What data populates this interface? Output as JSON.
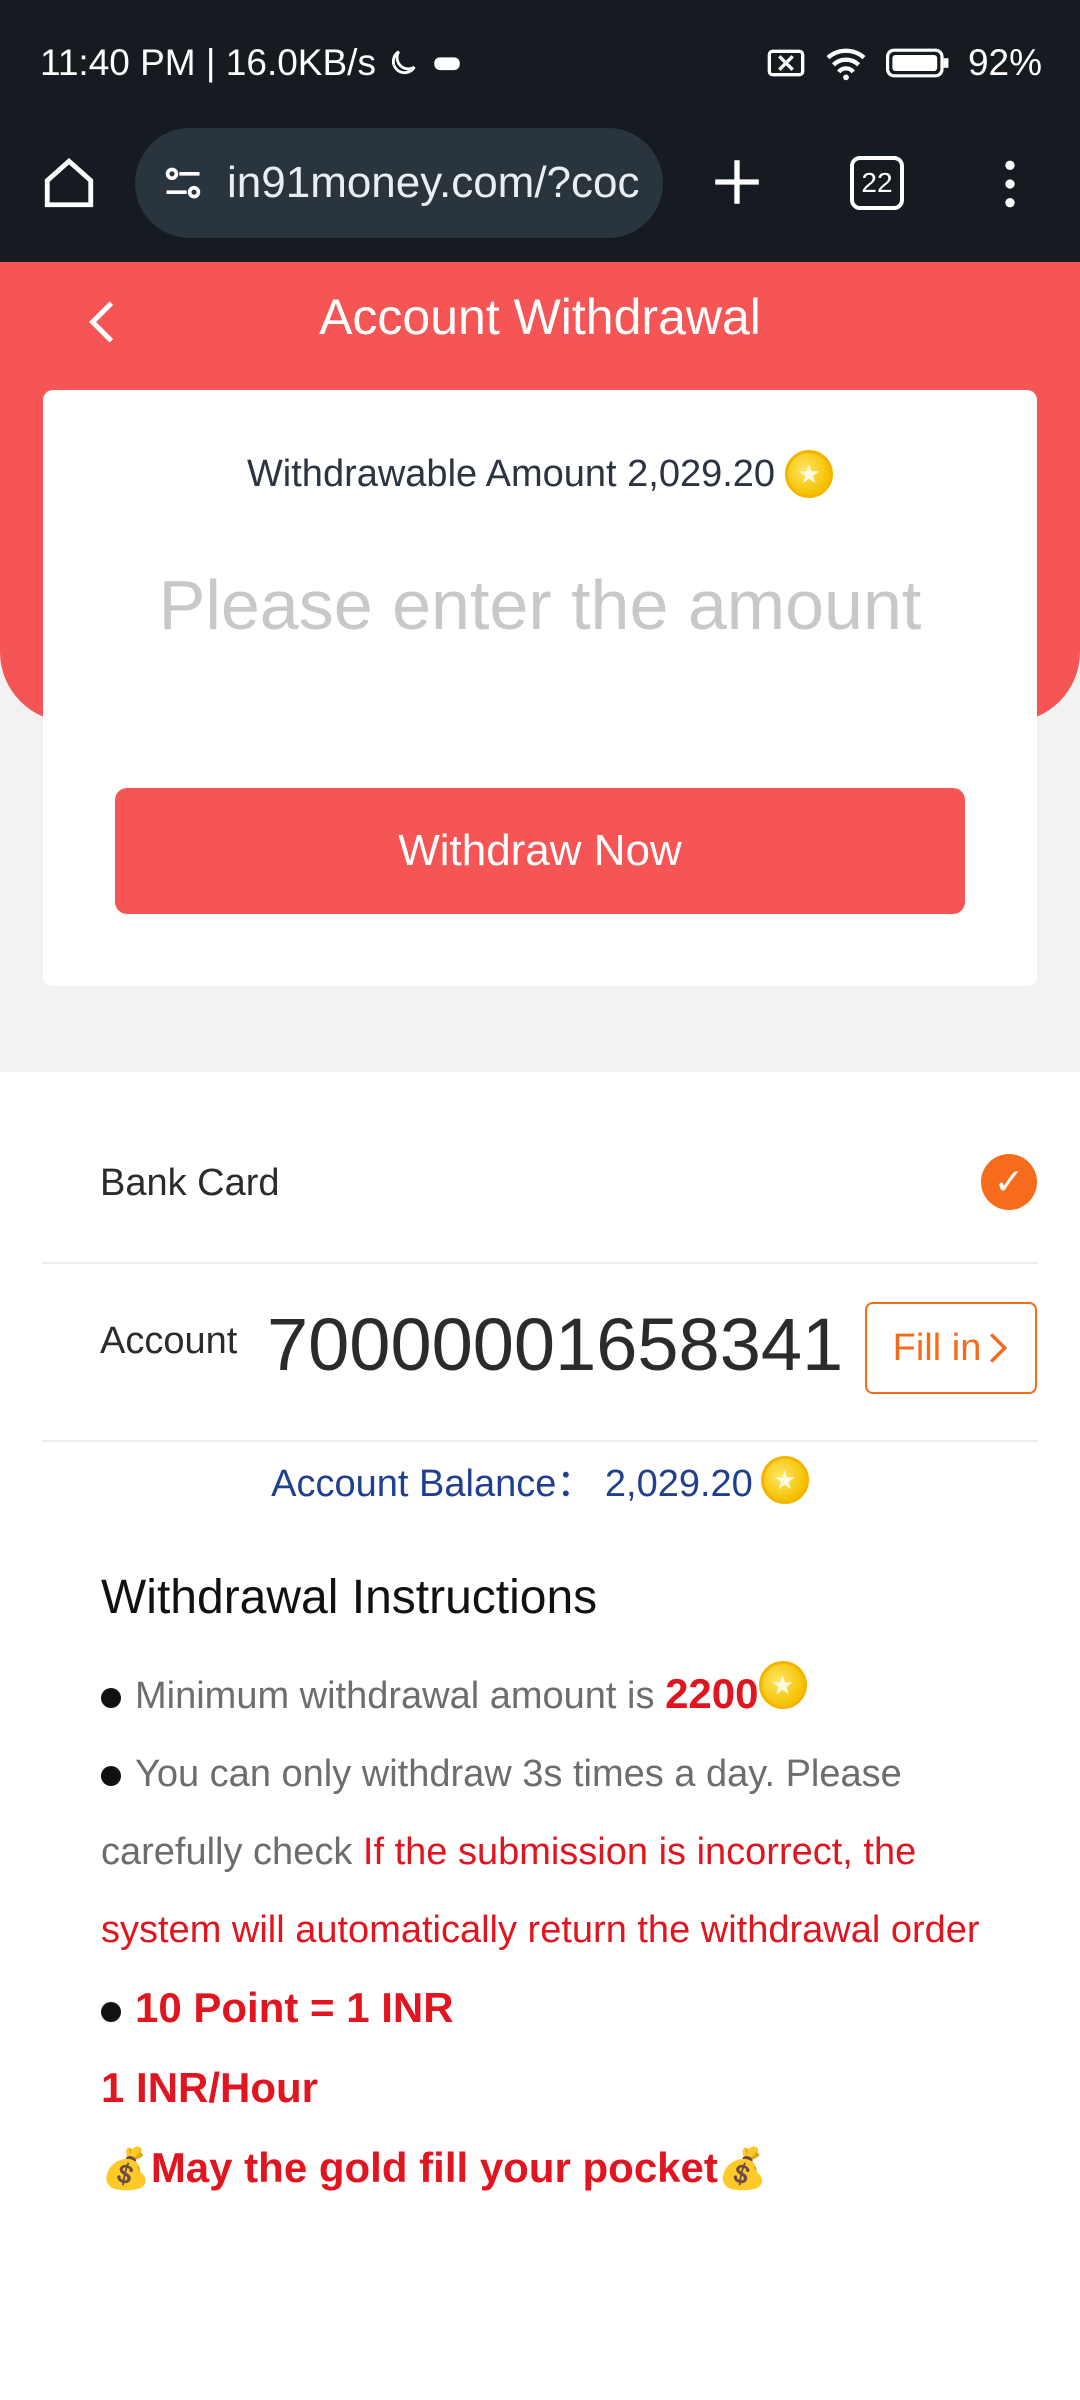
{
  "status_bar": {
    "time_info": "11:40 PM | 16.0KB/s",
    "battery": "92%"
  },
  "browser": {
    "url": "in91money.com/?coc",
    "tab_count": "22"
  },
  "header": {
    "title": "Account Withdrawal"
  },
  "withdraw_card": {
    "withdrawable_label": "Withdrawable Amount 2,029.20",
    "amount_placeholder": "Please enter the amount",
    "withdraw_button": "Withdraw Now"
  },
  "bank": {
    "label": "Bank Card",
    "account_label": "Account",
    "account_number": "70000001658341",
    "fill_button": "Fill in"
  },
  "balance": {
    "text": "Account Balance： 2,029.20"
  },
  "instructions": {
    "title": "Withdrawal Instructions",
    "min_text": "Minimum withdrawal amount is ",
    "min_value": "2200",
    "limit_text": "You can only withdraw 3s times a day. Please carefully check ",
    "limit_warning": "If the submission is incorrect, the system will automatically return the withdrawal order",
    "rate": "10 Point = 1 INR",
    "hourly": "1 INR/Hour",
    "blessing": "May the gold fill your pocket"
  },
  "colors": {
    "accent": "#f55555",
    "orange": "#f76b1c",
    "warning": "#e0151f",
    "balance_text": "#1f3f8f"
  }
}
